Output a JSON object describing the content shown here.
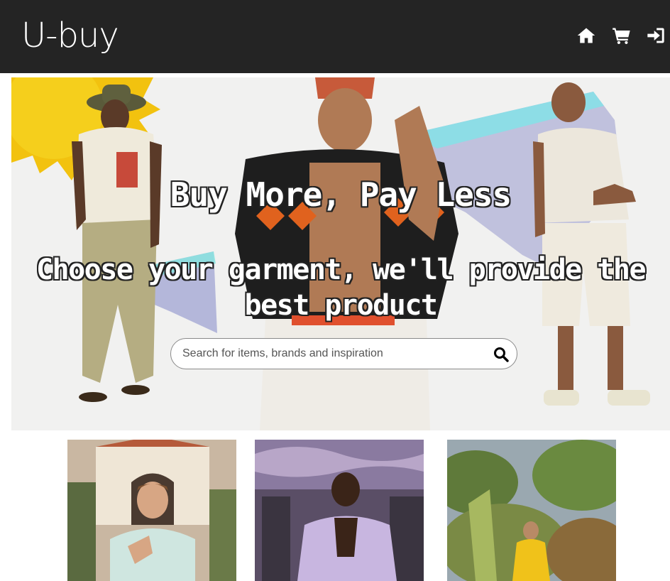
{
  "header": {
    "logo": "U-buy",
    "icons": [
      "home-icon",
      "cart-icon",
      "sign-in-icon"
    ],
    "colors": {
      "bar": "#242424",
      "icon": "#ffffff"
    }
  },
  "hero": {
    "headline": "Buy More, Pay Less",
    "subheadline": "Choose your garment, we'll provide the best product",
    "search": {
      "placeholder": "Search for items, brands and inspiration",
      "value": ""
    },
    "search_icon": "magnifier-icon"
  },
  "tiles": [
    {
      "name": "man-white-tee-photo"
    },
    {
      "name": "man-lilac-shirt-photo"
    },
    {
      "name": "woman-yellow-dress-photo"
    }
  ]
}
